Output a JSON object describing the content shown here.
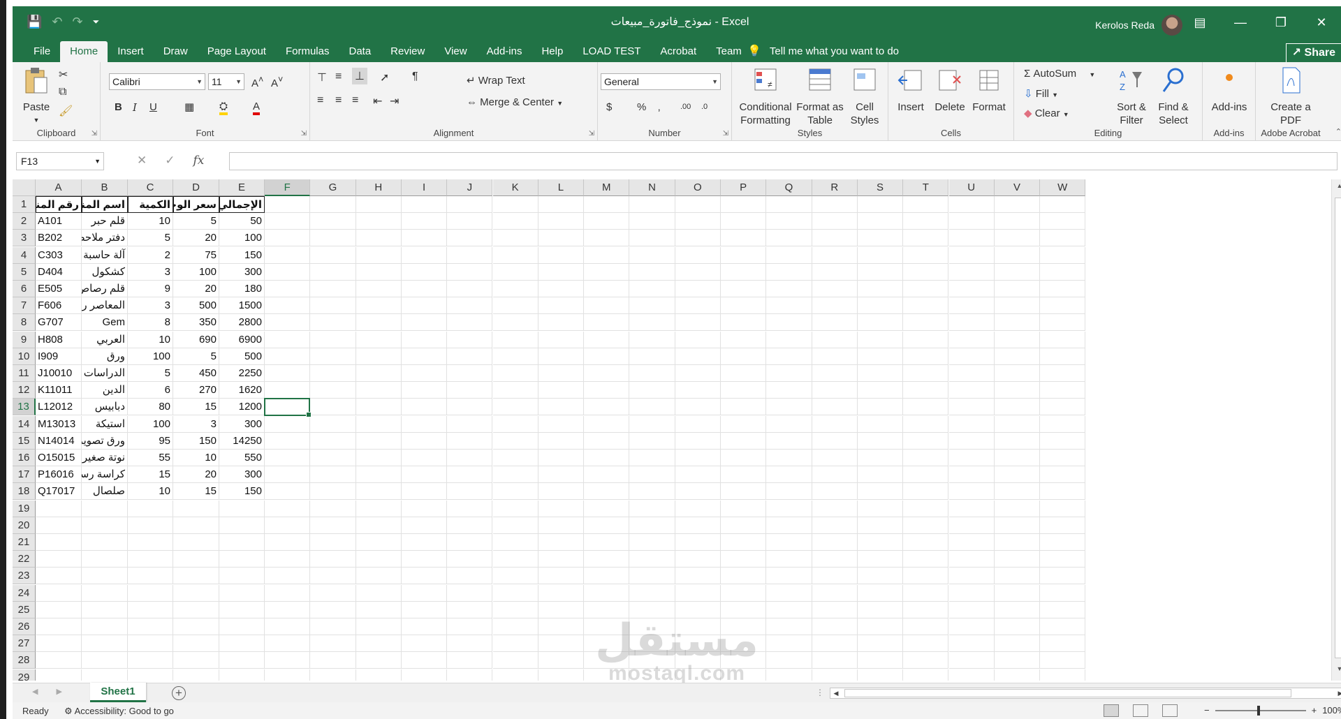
{
  "window": {
    "doc_title": "نموذج_فاتورة_مبيعات  -  Excel",
    "user_name": "Kerolos Reda",
    "share_label": "Share"
  },
  "tabs": [
    "File",
    "Home",
    "Insert",
    "Draw",
    "Page Layout",
    "Formulas",
    "Data",
    "Review",
    "View",
    "Add-ins",
    "Help",
    "LOAD TEST",
    "Acrobat",
    "Team"
  ],
  "active_tab": "Home",
  "tell_me": "Tell me what you want to do",
  "ribbon": {
    "clipboard": {
      "label": "Clipboard",
      "paste": "Paste"
    },
    "font": {
      "label": "Font",
      "font_name": "Calibri",
      "font_size": "11"
    },
    "alignment": {
      "label": "Alignment",
      "wrap_text": "Wrap Text",
      "merge_center": "Merge & Center"
    },
    "number": {
      "label": "Number",
      "format": "General"
    },
    "styles": {
      "label": "Styles",
      "conditional": "Conditional Formatting",
      "format_table": "Format as Table",
      "cell_styles": "Cell Styles"
    },
    "cells": {
      "label": "Cells",
      "insert": "Insert",
      "delete": "Delete",
      "format": "Format"
    },
    "editing": {
      "label": "Editing",
      "autosum": "AutoSum",
      "fill": "Fill",
      "clear": "Clear",
      "sort_filter": "Sort & Filter",
      "find_select": "Find & Select"
    },
    "addins": {
      "label": "Add-ins",
      "addins": "Add-ins"
    },
    "acrobat": {
      "label": "Adobe Acrobat",
      "create_pdf": "Create a PDF"
    }
  },
  "formula_bar": {
    "name_box": "F13",
    "formula": ""
  },
  "columns": [
    "A",
    "B",
    "C",
    "D",
    "E",
    "F",
    "G",
    "H",
    "I",
    "J",
    "K",
    "L",
    "M",
    "N",
    "O",
    "P",
    "Q",
    "R",
    "S",
    "T",
    "U",
    "V",
    "W"
  ],
  "selected_cell": {
    "col": "F",
    "row": 13
  },
  "table": {
    "headers": [
      "رقم المنتج",
      "اسم المنتج",
      "الكمية",
      "سعر الوحدة",
      "الإجمالي"
    ],
    "rows": [
      [
        "A101",
        "قلم حبر",
        "10",
        "5",
        "50"
      ],
      [
        "B202",
        "دفتر ملاحظات",
        "5",
        "20",
        "100"
      ],
      [
        "C303",
        "آلة حاسبة",
        "2",
        "75",
        "150"
      ],
      [
        "D404",
        "كشكول",
        "3",
        "100",
        "300"
      ],
      [
        "E505",
        "قلم رصاص",
        "9",
        "20",
        "180"
      ],
      [
        "F606",
        "المعاصر رياض",
        "3",
        "500",
        "1500"
      ],
      [
        "G707",
        "Gem",
        "8",
        "350",
        "2800"
      ],
      [
        "H808",
        "العربي",
        "10",
        "690",
        "6900"
      ],
      [
        "I909",
        "ورق",
        "100",
        "5",
        "500"
      ],
      [
        "J10010",
        "الدراسات",
        "5",
        "450",
        "2250"
      ],
      [
        "K11011",
        "الدين",
        "6",
        "270",
        "1620"
      ],
      [
        "L12012",
        "دبابيس",
        "80",
        "15",
        "1200"
      ],
      [
        "M13013",
        "استيكة",
        "100",
        "3",
        "300"
      ],
      [
        "N14014",
        "ورق تصوير",
        "95",
        "150",
        "14250"
      ],
      [
        "O15015",
        "نوتة صغيرة",
        "55",
        "10",
        "550"
      ],
      [
        "P16016",
        "كراسة رسم",
        "15",
        "20",
        "300"
      ],
      [
        "Q17017",
        "صلصال",
        "10",
        "15",
        "150"
      ]
    ]
  },
  "visible_rows": 29,
  "sheet_tab": "Sheet1",
  "status": {
    "ready": "Ready",
    "accessibility": "Accessibility: Good to go",
    "zoom": "100%"
  },
  "watermark": {
    "arabic": "مستقل",
    "latin": "mostaql.com"
  },
  "colors": {
    "accent": "#217346"
  }
}
